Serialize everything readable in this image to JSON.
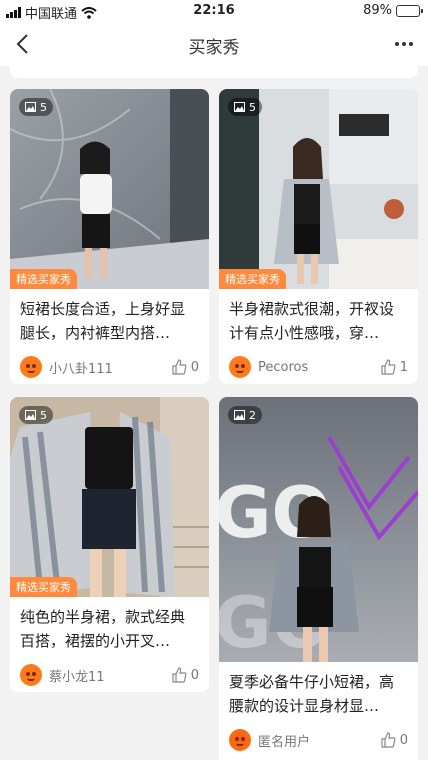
{
  "status_bar": {
    "carrier": "中国联通",
    "time": "22:16",
    "battery": "89%",
    "battery_level": 0.89
  },
  "nav": {
    "title": "买家秀"
  },
  "colors": {
    "featured_tag": "#ff8a3d",
    "avatar": "#ff7a1a",
    "page_bg": "#f2f2f2"
  },
  "featured_label": "精选买家秀",
  "posts": [
    {
      "image_count": "5",
      "featured": true,
      "title": "短裙长度合适，上身好显腿长，内衬裤型内搭…",
      "user": "小八卦111",
      "likes": "0"
    },
    {
      "image_count": "5",
      "featured": true,
      "title": "半身裙款式很潮，开衩设计有点小性感哦，穿…",
      "user": "Pecoros",
      "likes": "1"
    },
    {
      "image_count": "5",
      "featured": true,
      "title": "纯色的半身裙，款式经典百搭，裙摆的小开叉…",
      "user": "蔡小龙11",
      "likes": "0"
    },
    {
      "image_count": "2",
      "featured": false,
      "title": "夏季必备牛仔小短裙，高腰款的设计显身材显…",
      "user": "匿名用户",
      "likes": "0"
    }
  ]
}
